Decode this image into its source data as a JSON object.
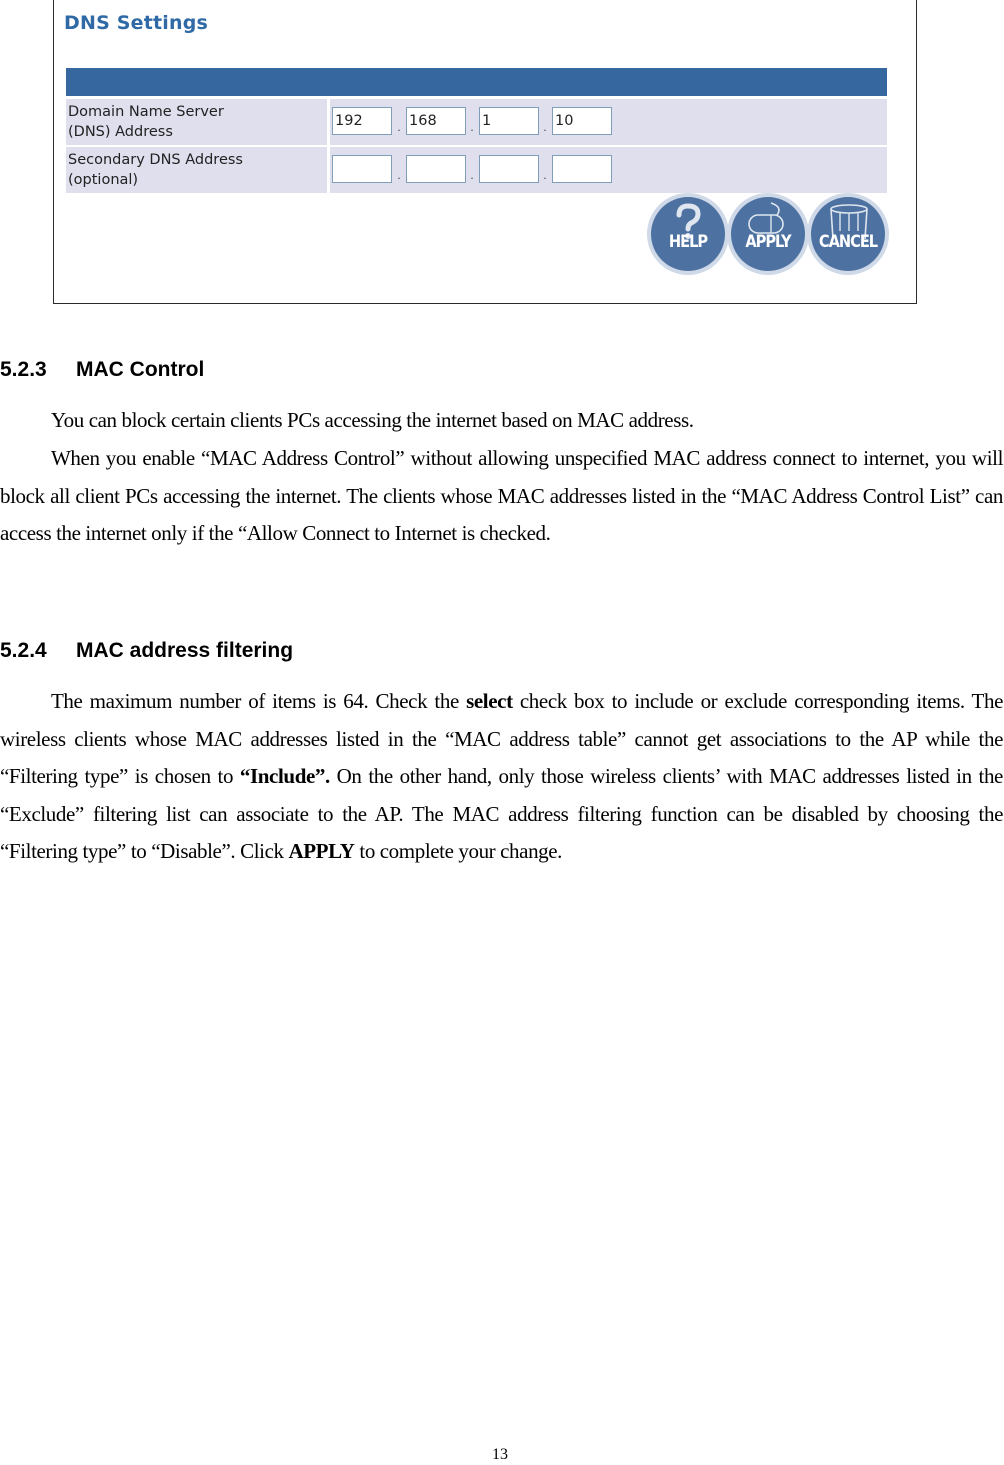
{
  "dns_panel": {
    "title": "DNS Settings",
    "rows": [
      {
        "label_line1": "Domain Name Server",
        "label_line2": "(DNS) Address",
        "octets": [
          "192",
          "168",
          "1",
          "10"
        ]
      },
      {
        "label_line1": "Secondary DNS Address",
        "label_line2": "(optional)",
        "octets": [
          "",
          "",
          "",
          ""
        ]
      }
    ],
    "separator": ".",
    "buttons": {
      "help": "HELP",
      "apply": "APPLY",
      "cancel": "CANCEL"
    },
    "colors": {
      "title": "#2f6aa6",
      "header_bar": "#36679e",
      "row_bg": "#dfdfee",
      "button": "#4d72a1"
    }
  },
  "sections": [
    {
      "number": "5.2.3",
      "title": "MAC Control",
      "paragraphs": [
        "You can block certain clients PCs accessing the internet based on MAC address.",
        "When you enable “MAC Address Control” without allowing unspecified MAC address connect to internet, you will block all client PCs accessing the internet. The clients whose MAC addresses listed in the “MAC Address Control List” can access the internet only if the “Allow Connect to Internet is checked."
      ]
    },
    {
      "number": "5.2.4",
      "title": "MAC address filtering",
      "p_part1": "The maximum number of items is 64. Check the ",
      "p_bold1": "select",
      "p_part2": " check box to include or exclude corresponding items. The wireless clients whose MAC addresses listed in the “MAC address table” cannot get associations to the AP while the “Filtering type” is chosen to ",
      "p_bold2": "“Include”.",
      "p_part3": " On the other hand, only those wireless clients’ with MAC addresses listed in the “Exclude” filtering list can associate to the AP. The MAC address filtering function can be disabled by choosing the “Filtering type” to “Disable”. Click ",
      "p_bold3": "APPLY",
      "p_part4": " to complete your change."
    }
  ],
  "page_number": "13"
}
